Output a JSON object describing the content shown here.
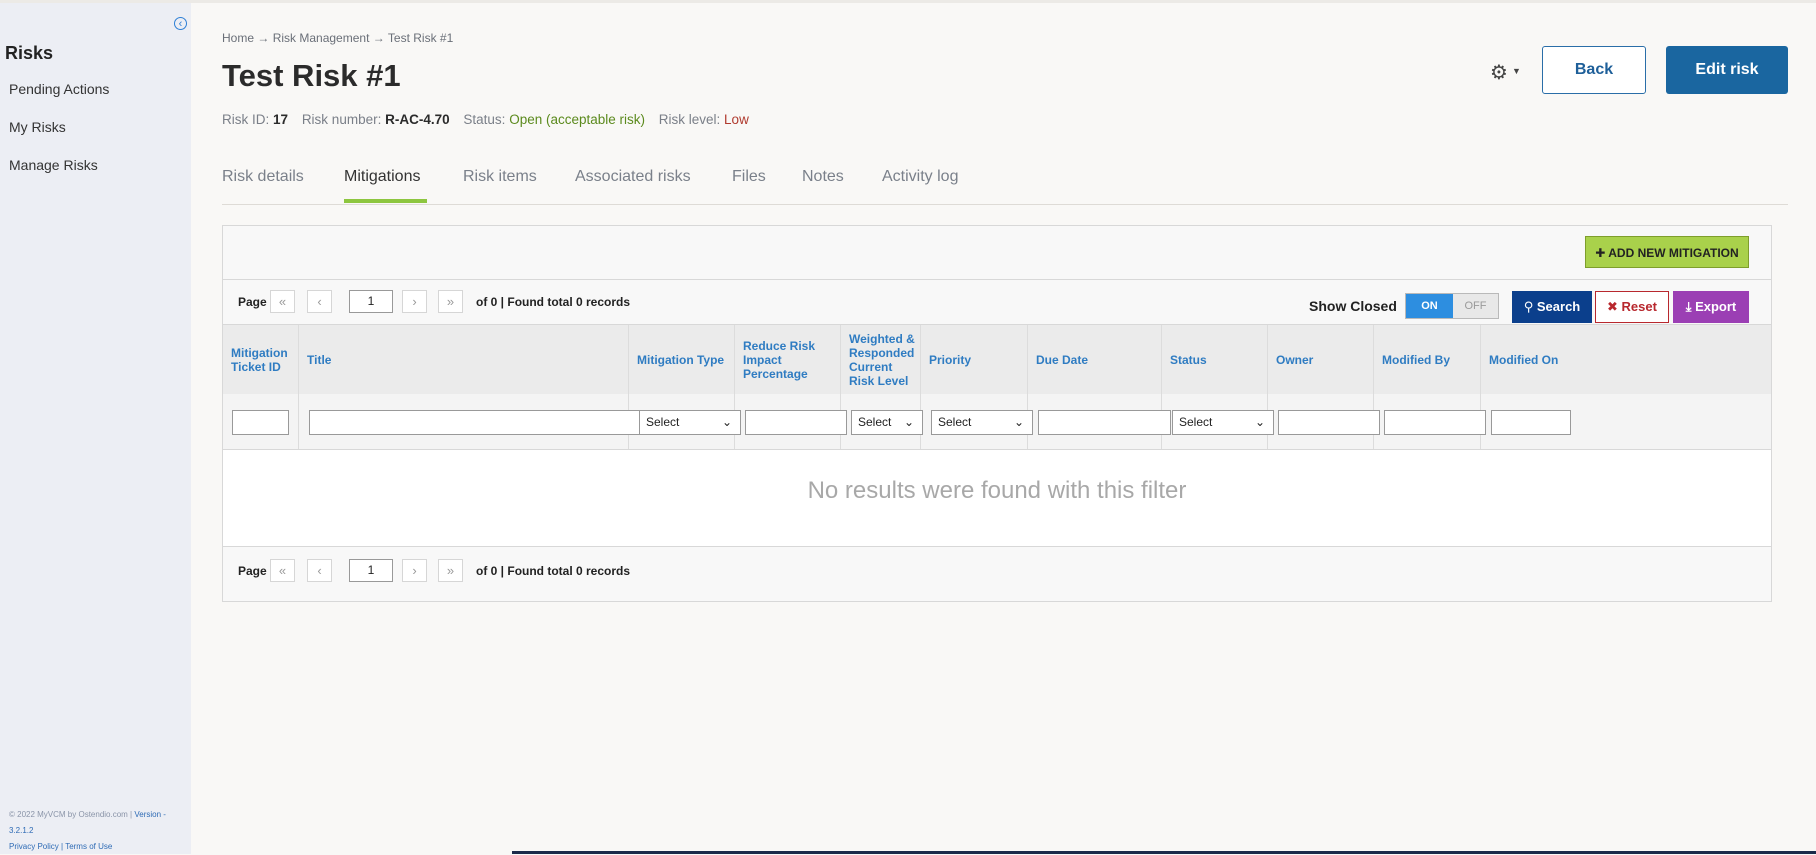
{
  "sidebar": {
    "title": "Risks",
    "items": [
      {
        "label": "Pending Actions"
      },
      {
        "label": "My Risks"
      },
      {
        "label": "Manage Risks"
      }
    ],
    "footer": {
      "copyright": "© 2022 MyVCM by Ostendio.com |",
      "version_link": "Version - 3.2.1.2",
      "privacy": "Privacy Policy",
      "sep": "|",
      "terms": "Terms of Use"
    }
  },
  "breadcrumb": {
    "home": "Home",
    "section": "Risk Management",
    "current": "Test Risk #1",
    "arrow": "→"
  },
  "header": {
    "title": "Test Risk #1",
    "risk_id_label": "Risk ID:",
    "risk_id": "17",
    "risk_number_label": "Risk number:",
    "risk_number": "R-AC-4.70",
    "status_label": "Status:",
    "status": "Open (acceptable risk)",
    "level_label": "Risk level:",
    "level": "Low",
    "back_label": "Back",
    "edit_label": "Edit risk"
  },
  "tabs": [
    {
      "label": "Risk details"
    },
    {
      "label": "Mitigations",
      "active": true
    },
    {
      "label": "Risk items"
    },
    {
      "label": "Associated risks"
    },
    {
      "label": "Files"
    },
    {
      "label": "Notes"
    },
    {
      "label": "Activity log"
    }
  ],
  "toolbar": {
    "add_label": "ADD NEW MITIGATION",
    "show_closed_label": "Show Closed",
    "toggle_on": "ON",
    "toggle_off": "OFF",
    "search_label": "Search",
    "reset_label": "Reset",
    "export_label": "Export"
  },
  "pager": {
    "page_label": "Page",
    "first": "«",
    "prev": "‹",
    "current_page": "1",
    "next": "›",
    "last": "»",
    "info": "of 0 | Found total 0 records"
  },
  "table": {
    "columns": [
      {
        "label": "Mitigation Ticket ID"
      },
      {
        "label": "Title"
      },
      {
        "label": "Mitigation Type"
      },
      {
        "label": "Reduce Risk Impact Percentage"
      },
      {
        "label": "Weighted & Responded Current Risk Level"
      },
      {
        "label": "Priority"
      },
      {
        "label": "Due Date"
      },
      {
        "label": "Status"
      },
      {
        "label": "Owner"
      },
      {
        "label": "Modified By"
      },
      {
        "label": "Modified On"
      }
    ],
    "select_placeholder": "Select",
    "empty_message": "No results were found with this filter"
  },
  "colors": {
    "primary": "#1a66a0",
    "accent_green": "#8dc63f",
    "search_blue": "#0b3f8c",
    "reset_red": "#b8282e",
    "export_purple": "#9b3fb4"
  }
}
